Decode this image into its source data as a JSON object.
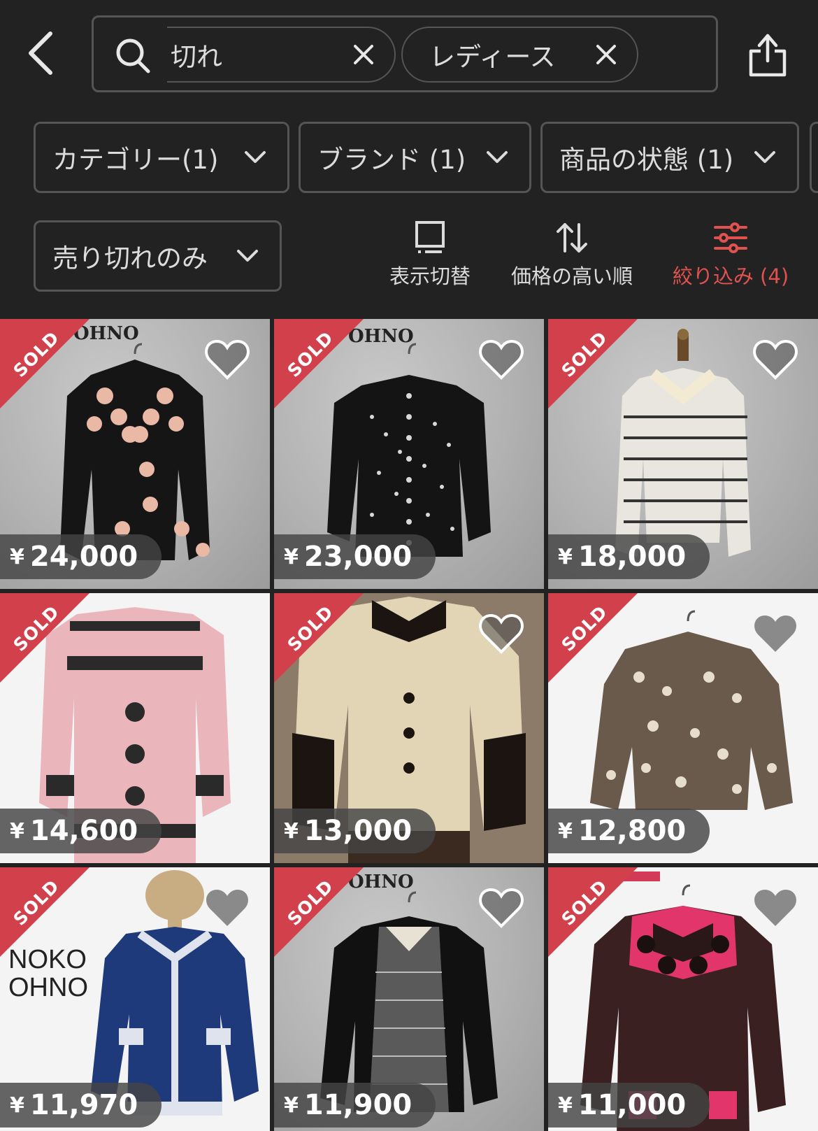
{
  "header": {
    "search_chips": [
      {
        "label": "切れ"
      },
      {
        "label": "レディース"
      }
    ]
  },
  "filters": {
    "category": "カテゴリー(1)",
    "brand": "ブランド (1)",
    "condition": "商品の状態 (1)",
    "sold_only": "売り切れのみ"
  },
  "toolbar": {
    "view_toggle": "表示切替",
    "sort": "価格の高い順",
    "refine": "絞り込み (4)"
  },
  "colors": {
    "accent": "#e0524f",
    "sold_ribbon": "#d2404b",
    "background": "#222222"
  },
  "products": [
    {
      "sold": "SOLD",
      "currency": "¥",
      "price": "24,000",
      "tag": "OHNO"
    },
    {
      "sold": "SOLD",
      "currency": "¥",
      "price": "23,000",
      "tag": "OHNO"
    },
    {
      "sold": "SOLD",
      "currency": "¥",
      "price": "18,000",
      "tag": ""
    },
    {
      "sold": "SOLD",
      "currency": "¥",
      "price": "14,600",
      "tag": ""
    },
    {
      "sold": "SOLD",
      "currency": "¥",
      "price": "13,000",
      "tag": ""
    },
    {
      "sold": "SOLD",
      "currency": "¥",
      "price": "12,800",
      "tag": ""
    },
    {
      "sold": "SOLD",
      "currency": "¥",
      "price": "11,970",
      "tag": "NOKO OHNO"
    },
    {
      "sold": "SOLD",
      "currency": "¥",
      "price": "11,900",
      "tag": "OHNO"
    },
    {
      "sold": "SOLD",
      "currency": "¥",
      "price": "11,000",
      "tag": ""
    }
  ],
  "icons": {
    "back": "chevron-left-icon",
    "search": "search-icon",
    "clear": "close-icon",
    "share": "share-icon",
    "dropdown": "chevron-down-icon",
    "view": "grid-view-icon",
    "sort": "sort-arrows-icon",
    "refine": "sliders-icon",
    "like": "heart-icon"
  }
}
